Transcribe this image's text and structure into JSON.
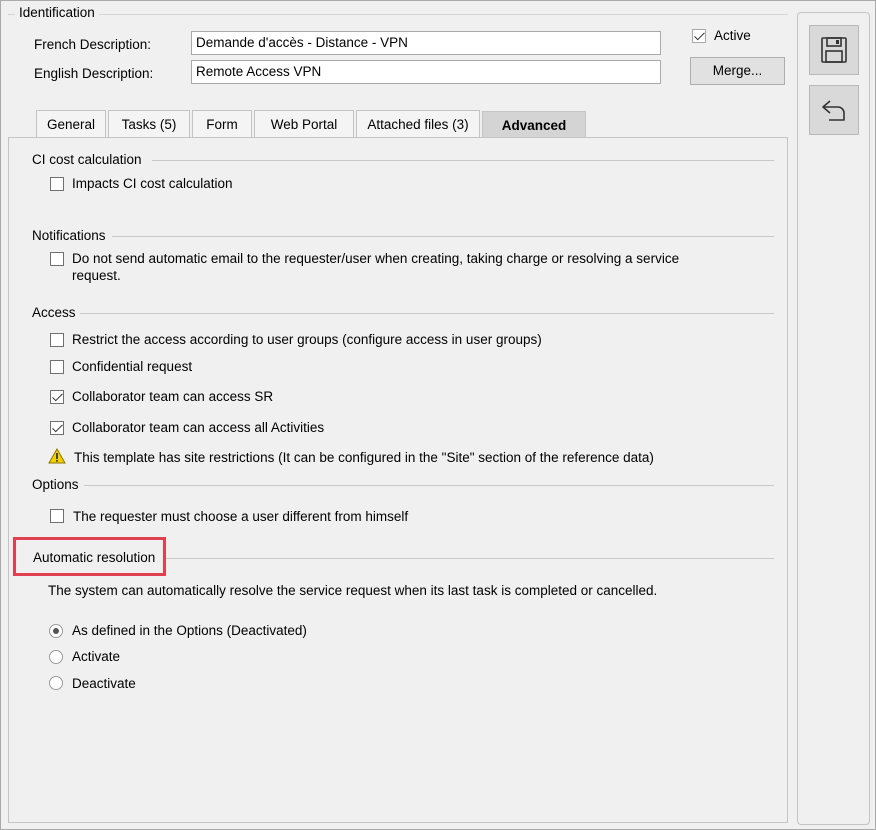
{
  "identification": {
    "group_title": "Identification",
    "french_label": "French Description:",
    "french_value": "Demande d'accès - Distance - VPN",
    "english_label": "English Description:",
    "english_value": "Remote Access VPN",
    "active_label": "Active",
    "active_checked": true,
    "merge_label": "Merge..."
  },
  "tabs": [
    {
      "label": "General"
    },
    {
      "label": "Tasks (5)"
    },
    {
      "label": "Form"
    },
    {
      "label": "Web Portal"
    },
    {
      "label": "Attached files (3)"
    },
    {
      "label": "Advanced",
      "active": true
    }
  ],
  "sections": {
    "ci": {
      "title": "CI cost calculation",
      "impacts_label": "Impacts CI cost calculation"
    },
    "notifications": {
      "title": "Notifications",
      "no_email_line1": "Do not send automatic email to the requester/user when creating, taking charge or resolving a service",
      "no_email_line2": "request."
    },
    "access": {
      "title": "Access",
      "restrict_label": "Restrict the access according to user groups (configure access in user groups)",
      "confidential_label": "Confidential request",
      "collab_sr_label": "Collaborator team can access SR",
      "collab_activities_label": "Collaborator team can access all Activities",
      "warning_text": "This template has site restrictions (It can be configured in the \"Site\" section of the reference data)"
    },
    "options": {
      "title": "Options",
      "different_user_label": "The requester must choose a user different from himself"
    },
    "auto_resolution": {
      "title": "Automatic resolution",
      "description": "The system can automatically resolve the service request when its last task is completed or cancelled.",
      "radio_defined": "As defined in the Options (Deactivated)",
      "radio_activate": "Activate",
      "radio_deactivate": "Deactivate"
    }
  },
  "icons": {
    "save": "save-icon",
    "undo": "undo-icon",
    "warning": "warning-icon"
  },
  "colors": {
    "highlight": "#e04050",
    "warning_yellow": "#f5d000"
  }
}
